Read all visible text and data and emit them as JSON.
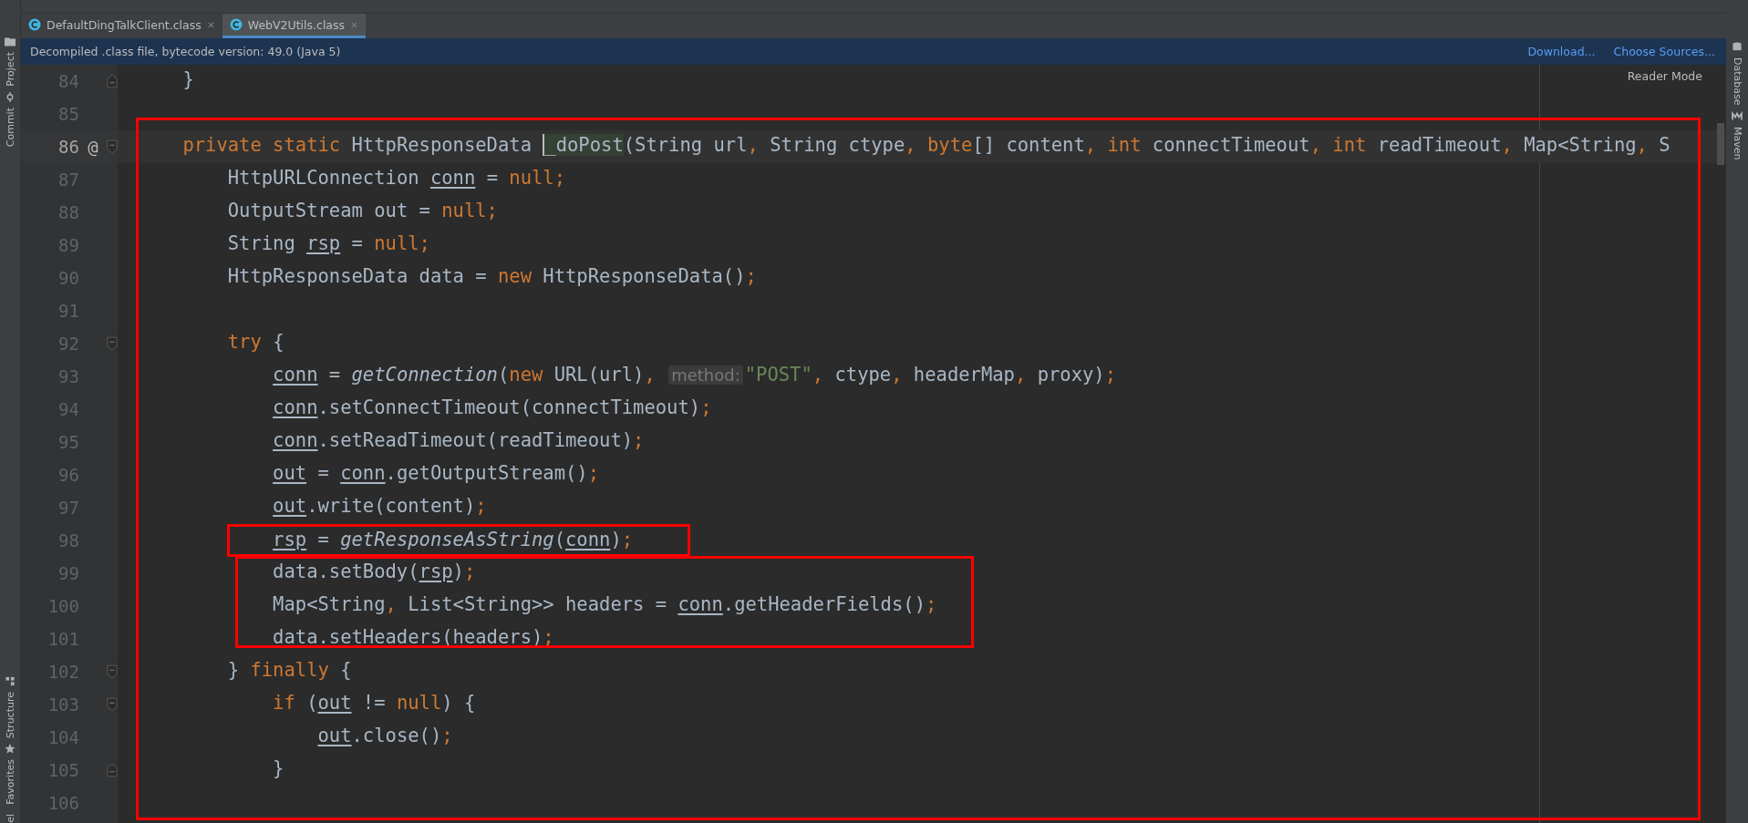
{
  "left_tools": [
    {
      "label": "Project"
    },
    {
      "label": "Commit"
    },
    {
      "label": "Structure"
    },
    {
      "label": "Favorites"
    },
    {
      "label": "el"
    }
  ],
  "tabs": [
    {
      "label": "DefaultDingTalkClient.class",
      "selected": false
    },
    {
      "label": "WebV2Utils.class",
      "selected": true
    }
  ],
  "notice": {
    "text": "Decompiled .class file, bytecode version: 49.0 (Java 5)",
    "links": [
      "Download...",
      "Choose Sources..."
    ]
  },
  "reader_mode": "Reader Mode",
  "lines": [
    {
      "number": "84",
      "current": false,
      "fold_end": true,
      "tokens": [
        {
          "text": "    }",
          "kind": "plain"
        }
      ]
    },
    {
      "number": "85",
      "current": false
    },
    {
      "number": "86",
      "current": true,
      "gutter_mark": "@",
      "fold_start": true,
      "tokens": [
        {
          "text": "    private static ",
          "kind": "keyword"
        },
        {
          "text": "HttpResponseData ",
          "kind": "plain"
        },
        {
          "text": "_doPost",
          "kind": "declaration"
        },
        {
          "text": "(String url",
          "kind": "plain"
        },
        {
          "text": ", ",
          "kind": "keyword"
        },
        {
          "text": "String ctype",
          "kind": "plain"
        },
        {
          "text": ", ",
          "kind": "keyword"
        },
        {
          "text": "byte",
          "kind": "keyword"
        },
        {
          "text": "[] content",
          "kind": "plain"
        },
        {
          "text": ", ",
          "kind": "keyword"
        },
        {
          "text": "int ",
          "kind": "keyword"
        },
        {
          "text": "connectTimeout",
          "kind": "plain"
        },
        {
          "text": ", ",
          "kind": "keyword"
        },
        {
          "text": "int ",
          "kind": "keyword"
        },
        {
          "text": "readTimeout",
          "kind": "plain"
        },
        {
          "text": ", ",
          "kind": "keyword"
        },
        {
          "text": "Map<String",
          "kind": "plain"
        },
        {
          "text": ", ",
          "kind": "keyword"
        },
        {
          "text": "S",
          "kind": "plain"
        }
      ]
    },
    {
      "number": "87",
      "current": false,
      "tokens": [
        {
          "text": "        HttpURLConnection ",
          "kind": "plain"
        },
        {
          "text": "conn",
          "kind": "variable"
        },
        {
          "text": " = ",
          "kind": "plain"
        },
        {
          "text": "null;",
          "kind": "keyword"
        }
      ]
    },
    {
      "number": "88",
      "current": false,
      "tokens": [
        {
          "text": "        OutputStream out = ",
          "kind": "plain"
        },
        {
          "text": "null;",
          "kind": "keyword"
        }
      ]
    },
    {
      "number": "89",
      "current": false,
      "tokens": [
        {
          "text": "        String ",
          "kind": "plain"
        },
        {
          "text": "rsp",
          "kind": "variable"
        },
        {
          "text": " = ",
          "kind": "plain"
        },
        {
          "text": "null;",
          "kind": "keyword"
        }
      ]
    },
    {
      "number": "90",
      "current": false,
      "tokens": [
        {
          "text": "        HttpResponseData data = ",
          "kind": "plain"
        },
        {
          "text": "new ",
          "kind": "keyword"
        },
        {
          "text": "HttpResponseData()",
          "kind": "plain"
        },
        {
          "text": ";",
          "kind": "keyword"
        }
      ]
    },
    {
      "number": "91",
      "current": false
    },
    {
      "number": "92",
      "current": false,
      "fold_start": true,
      "tokens": [
        {
          "text": "        try ",
          "kind": "keyword"
        },
        {
          "text": "{",
          "kind": "plain"
        }
      ]
    },
    {
      "number": "93",
      "current": false,
      "tokens": [
        {
          "text": "            conn",
          "kind": "variable"
        },
        {
          "text": " = ",
          "kind": "plain"
        },
        {
          "text": "getConnection",
          "kind": "static"
        },
        {
          "text": "(",
          "kind": "plain"
        },
        {
          "text": "new ",
          "kind": "keyword"
        },
        {
          "text": "URL(url)",
          "kind": "plain"
        },
        {
          "text": ", ",
          "kind": "keyword"
        },
        {
          "text": "method:",
          "kind": "hint"
        },
        {
          "text": "\"POST\"",
          "kind": "string"
        },
        {
          "text": ", ",
          "kind": "keyword"
        },
        {
          "text": "ctype",
          "kind": "plain"
        },
        {
          "text": ", ",
          "kind": "keyword"
        },
        {
          "text": "headerMap",
          "kind": "plain"
        },
        {
          "text": ", ",
          "kind": "keyword"
        },
        {
          "text": "proxy)",
          "kind": "plain"
        },
        {
          "text": ";",
          "kind": "keyword"
        }
      ]
    },
    {
      "number": "94",
      "current": false,
      "tokens": [
        {
          "text": "            conn",
          "kind": "variable"
        },
        {
          "text": ".setConnectTimeout(connectTimeout)",
          "kind": "plain"
        },
        {
          "text": ";",
          "kind": "keyword"
        }
      ]
    },
    {
      "number": "95",
      "current": false,
      "tokens": [
        {
          "text": "            conn",
          "kind": "variable"
        },
        {
          "text": ".setReadTimeout(readTimeout)",
          "kind": "plain"
        },
        {
          "text": ";",
          "kind": "keyword"
        }
      ]
    },
    {
      "number": "96",
      "current": false,
      "tokens": [
        {
          "text": "            out",
          "kind": "variable"
        },
        {
          "text": " = ",
          "kind": "plain"
        },
        {
          "text": "conn",
          "kind": "variable"
        },
        {
          "text": ".getOutputStream()",
          "kind": "plain"
        },
        {
          "text": ";",
          "kind": "keyword"
        }
      ]
    },
    {
      "number": "97",
      "current": false,
      "tokens": [
        {
          "text": "            out",
          "kind": "variable"
        },
        {
          "text": ".write(content)",
          "kind": "plain"
        },
        {
          "text": ";",
          "kind": "keyword"
        }
      ]
    },
    {
      "number": "98",
      "current": false,
      "framed": true,
      "tokens": [
        {
          "text": "            rsp",
          "kind": "variable"
        },
        {
          "text": " = ",
          "kind": "plain"
        },
        {
          "text": "getResponseAsString",
          "kind": "static"
        },
        {
          "text": "(",
          "kind": "plain"
        },
        {
          "text": "conn",
          "kind": "variable"
        },
        {
          "text": ")",
          "kind": "plain"
        },
        {
          "text": ";",
          "kind": "keyword"
        }
      ]
    },
    {
      "number": "99",
      "current": false,
      "tokens": [
        {
          "text": "            data.setBody(",
          "kind": "plain"
        },
        {
          "text": "rsp",
          "kind": "variable"
        },
        {
          "text": ")",
          "kind": "plain"
        },
        {
          "text": ";",
          "kind": "keyword"
        }
      ]
    },
    {
      "number": "100",
      "current": false,
      "tokens": [
        {
          "text": "            Map<String",
          "kind": "plain"
        },
        {
          "text": ", ",
          "kind": "keyword"
        },
        {
          "text": "List<String>> headers = ",
          "kind": "plain"
        },
        {
          "text": "conn",
          "kind": "variable"
        },
        {
          "text": ".getHeaderFields()",
          "kind": "plain"
        },
        {
          "text": ";",
          "kind": "keyword"
        }
      ]
    },
    {
      "number": "101",
      "current": false,
      "tokens": [
        {
          "text": "            data.setHeaders(headers)",
          "kind": "plain"
        },
        {
          "text": ";",
          "kind": "keyword"
        }
      ]
    },
    {
      "number": "102",
      "current": false,
      "fold_start": true,
      "tokens": [
        {
          "text": "        } ",
          "kind": "plain"
        },
        {
          "text": "finally ",
          "kind": "keyword"
        },
        {
          "text": "{",
          "kind": "plain"
        }
      ]
    },
    {
      "number": "103",
      "current": false,
      "fold_start": true,
      "tokens": [
        {
          "text": "            if ",
          "kind": "keyword"
        },
        {
          "text": "(",
          "kind": "plain"
        },
        {
          "text": "out",
          "kind": "variable"
        },
        {
          "text": " != ",
          "kind": "plain"
        },
        {
          "text": "null",
          "kind": "keyword"
        },
        {
          "text": ") {",
          "kind": "plain"
        }
      ]
    },
    {
      "number": "104",
      "current": false,
      "tokens": [
        {
          "text": "                out",
          "kind": "variable"
        },
        {
          "text": ".close()",
          "kind": "plain"
        },
        {
          "text": ";",
          "kind": "keyword"
        }
      ]
    },
    {
      "number": "105",
      "current": false,
      "fold_end": true,
      "tokens": [
        {
          "text": "            }",
          "kind": "plain"
        }
      ]
    },
    {
      "number": "106",
      "current": false
    }
  ],
  "right_tools": [
    {
      "label": "Database"
    },
    {
      "label": "Maven"
    }
  ]
}
